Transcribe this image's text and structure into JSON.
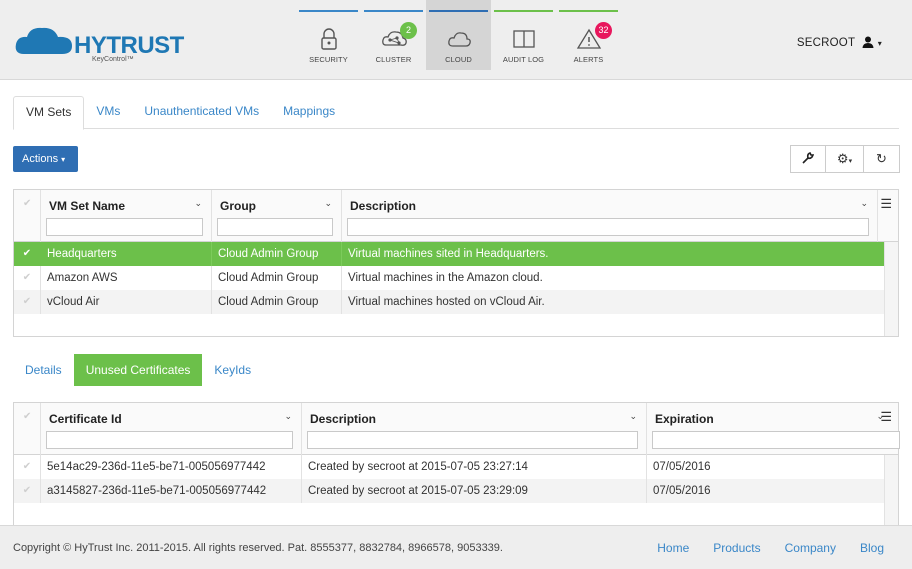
{
  "brand": {
    "name": "HYTRUST",
    "product": "KeyControl™",
    "color": "#1f78b4"
  },
  "nav": [
    {
      "label": "SECURITY",
      "icon": "lock-icon",
      "bar_color": "#3a87c8",
      "badge": null
    },
    {
      "label": "CLUSTER",
      "icon": "cluster-icon",
      "bar_color": "#3a87c8",
      "badge": "2",
      "badge_color": "#6cc04a"
    },
    {
      "label": "CLOUD",
      "icon": "cloud-icon",
      "bar_color": "#2f6eb3",
      "badge": null,
      "active": true
    },
    {
      "label": "AUDIT LOG",
      "icon": "book-icon",
      "bar_color": "#6cc04a",
      "badge": null
    },
    {
      "label": "ALERTS",
      "icon": "warning-icon",
      "bar_color": "#6cc04a",
      "badge": "32",
      "badge_color": "#e8175d"
    }
  ],
  "user": {
    "name": "SECROOT",
    "icon": "user-icon"
  },
  "tabs": [
    {
      "label": "VM Sets",
      "active": true
    },
    {
      "label": "VMs"
    },
    {
      "label": "Unauthenticated VMs"
    },
    {
      "label": "Mappings"
    }
  ],
  "actions_label": "Actions",
  "toolbar": {
    "icons": [
      "wrench-icon",
      "gear-icon",
      "refresh-icon"
    ]
  },
  "vmsets": {
    "columns": [
      "VM Set Name",
      "Group",
      "Description"
    ],
    "rows": [
      {
        "name": "Headquarters",
        "group": "Cloud Admin Group",
        "description": "Virtual machines sited in Headquarters.",
        "selected": true
      },
      {
        "name": "Amazon AWS",
        "group": "Cloud Admin Group",
        "description": "Virtual machines in the Amazon cloud."
      },
      {
        "name": "vCloud Air",
        "group": "Cloud Admin Group",
        "description": "Virtual machines hosted on vCloud Air."
      }
    ]
  },
  "subtabs": [
    {
      "label": "Details"
    },
    {
      "label": "Unused Certificates",
      "active": true
    },
    {
      "label": "KeyIds"
    }
  ],
  "certs": {
    "columns": [
      "Certificate Id",
      "Description",
      "Expiration"
    ],
    "rows": [
      {
        "id": "5e14ac29-236d-11e5-be71-005056977442",
        "description": "Created by secroot at 2015-07-05 23:27:14",
        "expiration": "07/05/2016"
      },
      {
        "id": "a3145827-236d-11e5-be71-005056977442",
        "description": "Created by secroot at 2015-07-05 23:29:09",
        "expiration": "07/05/2016"
      }
    ]
  },
  "footer": {
    "copyright": "Copyright © HyTrust Inc. 2011-2015. All rights reserved. Pat. 8555377, 8832784, 8966578, 9053339.",
    "links": [
      "Home",
      "Products",
      "Company",
      "Blog"
    ]
  },
  "colors": {
    "accent": "#2f6eb3",
    "selected": "#6cc04a",
    "link": "#3a87c8"
  }
}
